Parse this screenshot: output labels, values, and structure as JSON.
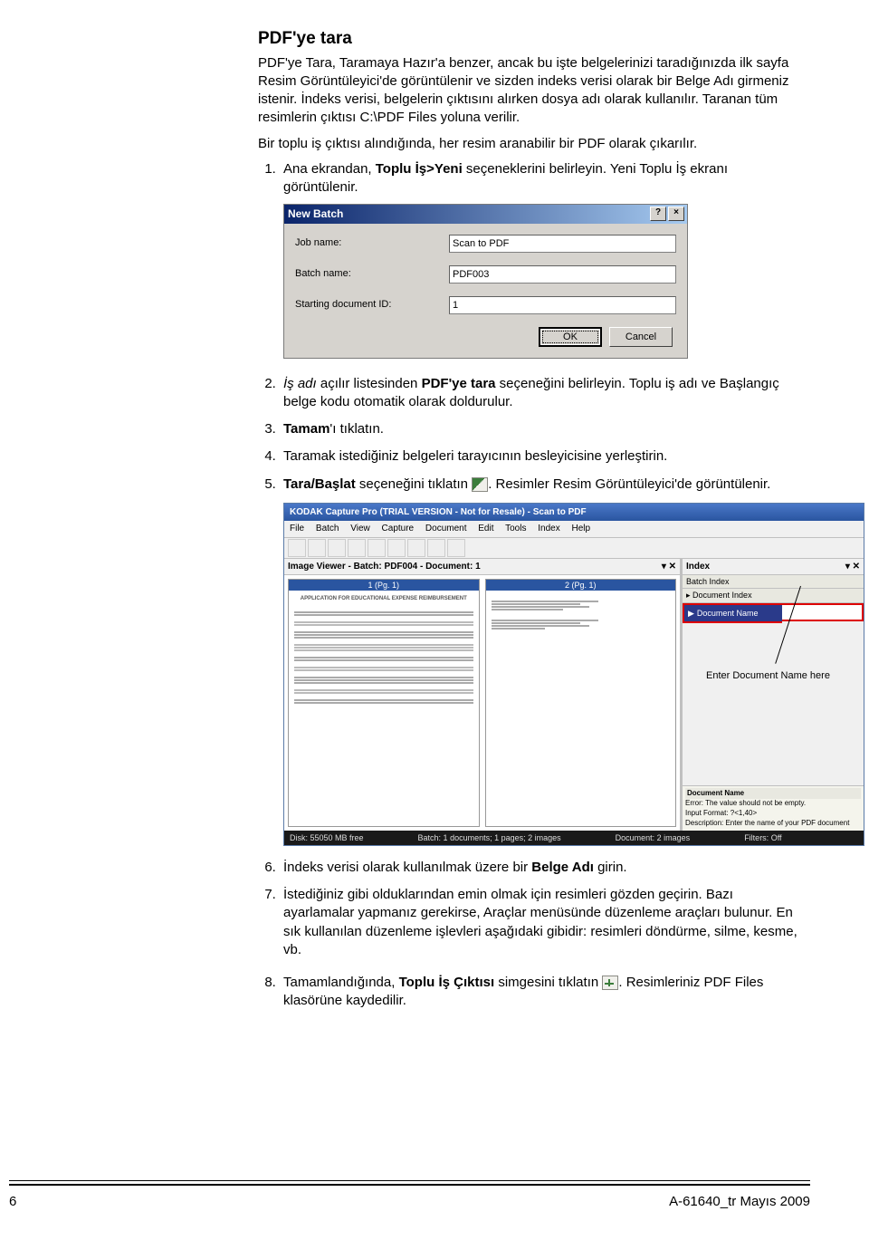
{
  "page_title": "PDF'ye tara",
  "intro_para": "PDF'ye Tara, Taramaya Hazır'a benzer, ancak bu işte belgelerinizi taradığınızda ilk sayfa Resim Görüntüleyici'de görüntülenir ve sizden indeks verisi olarak bir Belge Adı girmeniz istenir. İndeks verisi, belgelerin çıktısını alırken dosya adı olarak kullanılır. Taranan tüm resimlerin çıktısı C:\\PDF Files yoluna verilir.",
  "intro_para2": "Bir toplu iş çıktısı alındığında, her resim aranabilir bir PDF olarak çıkarılır.",
  "steps": {
    "s1a": "Ana ekrandan, ",
    "s1b": "Toplu İş>Yeni",
    "s1c": " seçeneklerini belirleyin. Yeni Toplu İş ekranı görüntülenir.",
    "s2a": "İş adı",
    "s2b": " açılır listesinden ",
    "s2c": "PDF'ye tara",
    "s2d": " seçeneğini belirleyin. Toplu iş adı ve Başlangıç belge kodu otomatik olarak doldurulur.",
    "s3a": "Tamam",
    "s3b": "'ı tıklatın.",
    "s4": "Taramak istediğiniz belgeleri tarayıcının besleyicisine yerleştirin.",
    "s5a": "Tara/Başlat",
    "s5b": " seçeneğini tıklatın ",
    "s5c": ". Resimler Resim Görüntüleyici'de görüntülenir.",
    "s6a": "İndeks verisi olarak kullanılmak üzere bir ",
    "s6b": "Belge Adı",
    "s6c": " girin.",
    "s7": "İstediğiniz gibi olduklarından emin olmak için resimleri gözden geçirin. Bazı ayarlamalar yapmanız gerekirse, Araçlar menüsünde düzenleme araçları bulunur. En sık kullanılan düzenleme işlevleri aşağıdaki gibidir: resimleri döndürme, silme, kesme, vb.",
    "s8a": "Tamamlandığında, ",
    "s8b": "Toplu İş Çıktısı",
    "s8c": " simgesini tıklatın ",
    "s8d": ". Resimleriniz PDF Files klasörüne kaydedilir."
  },
  "dialog": {
    "title": "New Batch",
    "help_btn": "?",
    "close_btn": "×",
    "job_label": "Job name:",
    "job_value": "Scan to PDF",
    "batch_label": "Batch name:",
    "batch_value": "PDF003",
    "startid_label": "Starting document ID:",
    "startid_value": "1",
    "ok": "OK",
    "cancel": "Cancel"
  },
  "app": {
    "title": "KODAK Capture Pro (TRIAL VERSION - Not for Resale) - Scan to PDF",
    "menu": [
      "File",
      "Batch",
      "View",
      "Capture",
      "Document",
      "Edit",
      "Tools",
      "Index",
      "Help"
    ],
    "viewer_header": "Image Viewer - Batch: PDF004 - Document: 1",
    "page_title_1": "1 (Pg. 1)",
    "page_title_2": "2 (Pg. 1)",
    "doc_heading": "APPLICATION FOR EDUCATIONAL EXPENSE REIMBURSEMENT",
    "index_tab": "Index",
    "batch_index": "Batch Index",
    "doc_index": "Document Index",
    "field_label": "Document Name",
    "annot": "Enter Document Name here",
    "err_title": "Document Name",
    "err_l1": "Error: The value should not be empty.",
    "err_l2": "Input Format: ?<1,40>",
    "err_l3": "Description: Enter the name of your PDF document",
    "status_disk": "Disk: 55050 MB free",
    "status_batch": "Batch: 1 documents; 1 pages; 2 images",
    "status_doc": "Document: 2 images",
    "status_filters": "Filters: Off"
  },
  "footer": {
    "page": "6",
    "doc": "A-61640_tr  Mayıs 2009"
  }
}
